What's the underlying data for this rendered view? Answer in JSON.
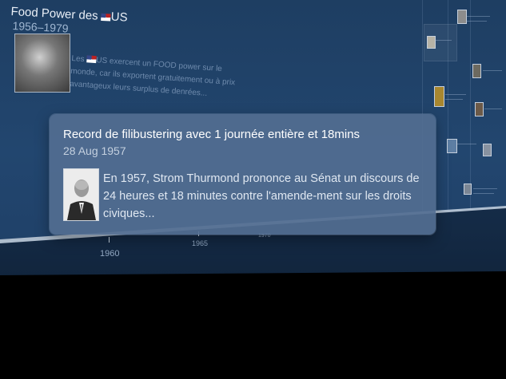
{
  "background_event": {
    "title": "Food Power des",
    "flag_suffix": "US",
    "years": "1956–1979",
    "text_prefix": "Les",
    "text_flag_suffix": "US",
    "text_rest": "exercent un FOOD power sur le monde, car ils exportent gratuitement ou à prix avantageux leurs surplus de denrées..."
  },
  "axis": {
    "years": [
      "1960",
      "1965",
      "1970"
    ]
  },
  "popup": {
    "title": "Record de filibustering avec 1 journée entière et 18mins",
    "date": "28 Aug 1957",
    "text": "En 1957, Strom Thurmond prononce au Sénat un discours de 24 heures et 18 minutes contre l'amende-ment sur les droits civiques..."
  },
  "colors": {
    "wall": "#22466f",
    "popup_bg": "#526e91",
    "accent": "#c9d6e4"
  }
}
